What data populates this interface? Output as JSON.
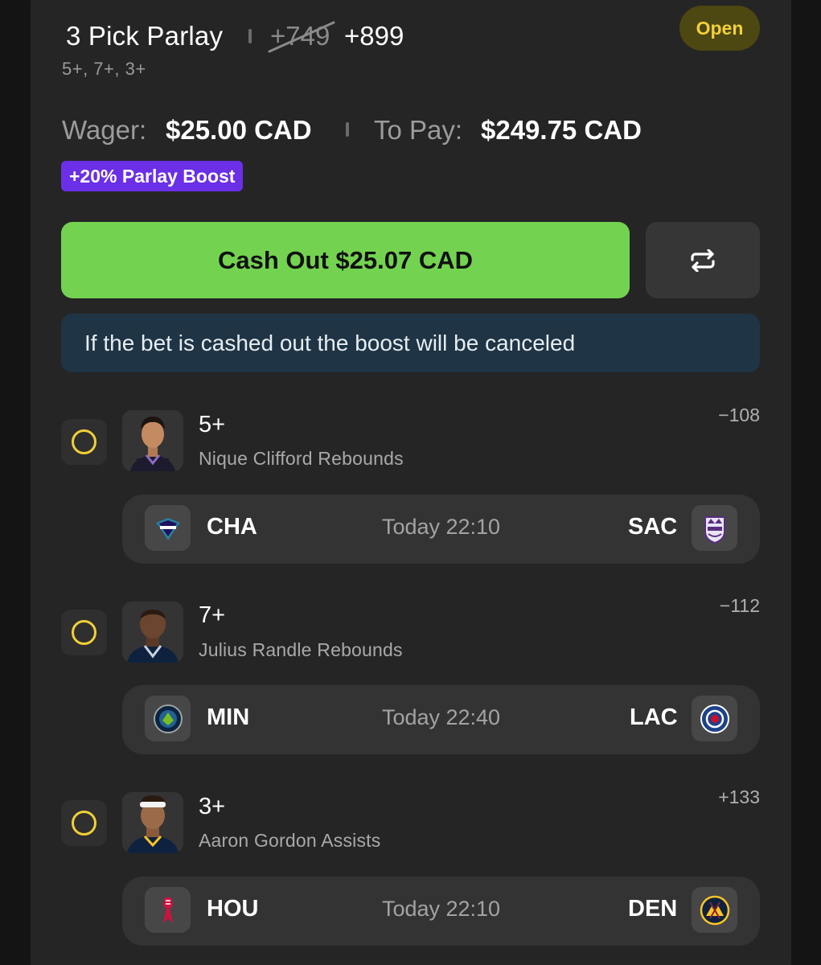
{
  "parlay": {
    "title": "3 Pick Parlay",
    "old_odds": "+749",
    "new_odds": "+899",
    "subtitle": "5+, 7+, 3+",
    "status": "Open"
  },
  "wager": {
    "label": "Wager:",
    "value": "$25.00 CAD",
    "pay_label": "To Pay:",
    "pay_value": "$249.75 CAD"
  },
  "boost_badge": "+20% Parlay Boost",
  "cashout_label": "Cash Out $25.07 CAD",
  "notice": "If the bet is cashed out the boost will be canceled",
  "legs": [
    {
      "line": "5+",
      "desc": "Nique Clifford Rebounds",
      "odds": "−108",
      "home": "CHA",
      "away": "SAC",
      "time": "Today 22:10"
    },
    {
      "line": "7+",
      "desc": "Julius Randle Rebounds",
      "odds": "−112",
      "home": "MIN",
      "away": "LAC",
      "time": "Today 22:40"
    },
    {
      "line": "3+",
      "desc": "Aaron Gordon Assists",
      "odds": "+133",
      "home": "HOU",
      "away": "DEN",
      "time": "Today 22:10"
    }
  ],
  "icons": {
    "refresh": "repeat-arrows-icon",
    "radio": "radio-unchecked-icon",
    "team_logos": [
      "hornets-logo",
      "kings-logo",
      "timberwolves-logo",
      "clippers-logo",
      "rockets-logo",
      "nuggets-logo"
    ]
  },
  "colors": {
    "cashout_green": "#73d351",
    "boost_purple": "#6a2fe6",
    "status_yellow": "#f1d13a",
    "notice_bg": "#1f3444"
  }
}
